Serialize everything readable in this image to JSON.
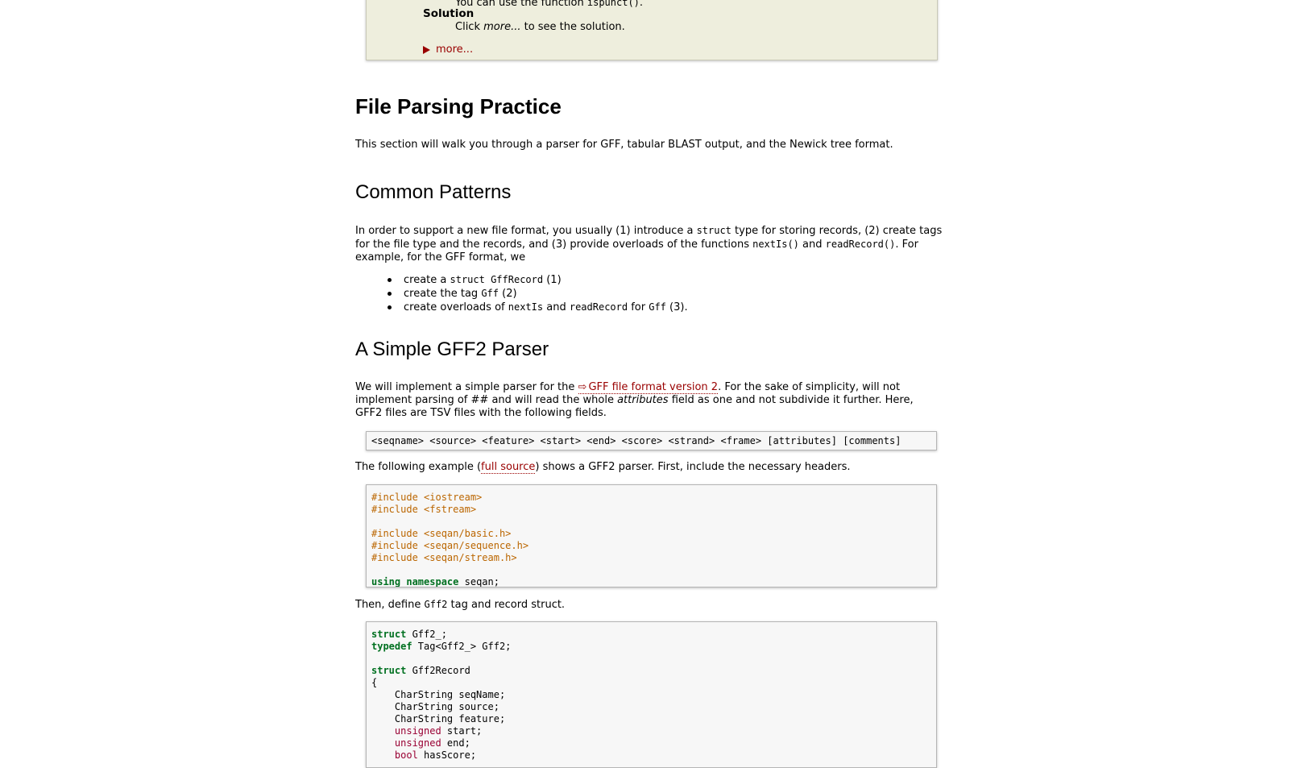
{
  "assignment": {
    "hint_prefix": "You can use the function ",
    "hint_code": "ispunct()",
    "hint_suffix": ".",
    "solution_label": "Solution",
    "solution_click": "Click ",
    "solution_more": "more...",
    "solution_rest": " to see the solution.",
    "more_link": "more..."
  },
  "section1": {
    "title": "File Parsing Practice",
    "intro": "This section will walk you through a parser for GFF, tabular BLAST output, and the Newick tree format."
  },
  "section2": {
    "title": "Common Patterns",
    "para": {
      "t1": "In order to support a new file format, you usually (1) introduce a ",
      "c1": "struct",
      "t2": " type for storing records, (2) create tags for the file type and the records, and (3) provide overloads of the functions ",
      "c2": "nextIs()",
      "t3": " and ",
      "c3": "readRecord()",
      "t4": ". For example, for the GFF format, we"
    },
    "bullets": [
      {
        "t1": "create a ",
        "c1": "struct GffRecord",
        "t2": " (1)"
      },
      {
        "t1": "create the tag ",
        "c1": "Gff",
        "t2": " (2)"
      },
      {
        "t1": "create overloads of ",
        "c1": "nextIs",
        "t2": " and ",
        "c2": "readRecord",
        "t3": " for ",
        "c3": "Gff",
        "t4": " (3)."
      }
    ]
  },
  "section3": {
    "title": "A Simple GFF2 Parser",
    "para": {
      "t1": "We will implement a simple parser for the ",
      "link_icon": "external-link-icon",
      "link": "GFF file format version 2",
      "t2": ". For the sake of simplicity, will not implement parsing of ",
      "e1": "##",
      "t3": " and will read the whole ",
      "e2": "attributes",
      "t4": " field as one and not subdivide it further. Here, GFF2 files are TSV files with the following fields."
    },
    "fields_line": "<seqname> <source> <feature> <start> <end> <score> <strand> <frame> [attributes] [comments]",
    "example": {
      "t1": "The following example (",
      "link": "full source",
      "t2": ") shows a GFF2 parser. First, include the necessary headers."
    },
    "headers_code": [
      "#include <iostream>",
      "#include <fstream>",
      "",
      "#include <seqan/basic.h>",
      "#include <seqan/sequence.h>",
      "#include <seqan/stream.h>"
    ],
    "using_kw1": "using",
    "using_kw2": "namespace",
    "using_rest": " seqan;",
    "then": {
      "t1": "Then, define ",
      "c1": "Gff2",
      "t2": " tag and record struct."
    },
    "struct_code": {
      "l1_kw": "struct",
      "l1_rest": " Gff2_;",
      "l2_kw": "typedef",
      "l2_rest": " Tag<Gff2_> Gff2;",
      "l4_kw": "struct",
      "l4_rest": " Gff2Record",
      "l5": "{",
      "l6": "    CharString seqName;",
      "l7": "    CharString source;",
      "l8": "    CharString feature;",
      "l9_ty": "unsigned",
      "l9_rest": " start;",
      "l10_ty": "unsigned",
      "l10_rest": " end;",
      "l11_ty": "bool",
      "l11_rest": " hasScore;"
    }
  },
  "colors": {
    "link": "#990000",
    "box_bg": "#eeeedd",
    "code_bg": "#f7f7f7",
    "preprocessor": "#bb6600",
    "keyword": "#007020",
    "type": "#990033"
  }
}
